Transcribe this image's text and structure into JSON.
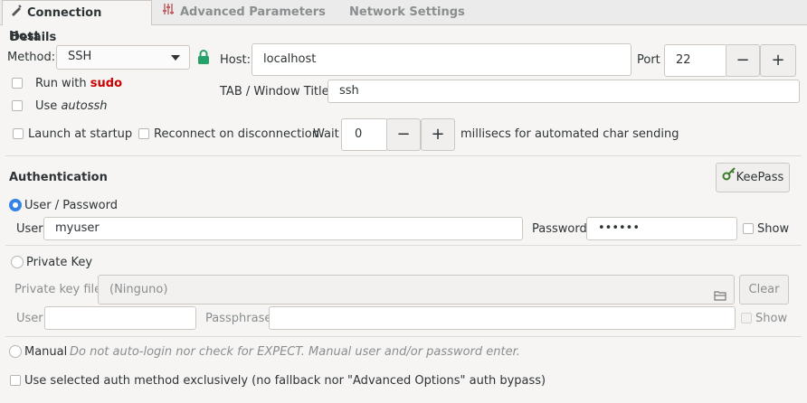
{
  "tabs": [
    {
      "label": "Connection Details"
    },
    {
      "label": "Advanced Parameters"
    },
    {
      "label": "Network Settings"
    }
  ],
  "host_section": {
    "title": "Host",
    "method_label": "Method:",
    "method_value": "SSH",
    "host_label": "Host:",
    "host_value": "localhost",
    "port_label": "Port",
    "port_value": "22",
    "run_with_prefix": "Run with",
    "run_with_cmd": "sudo",
    "use_prefix": "Use",
    "use_cmd": "autossh",
    "title_label": "TAB / Window Title:",
    "title_value": "ssh"
  },
  "options": {
    "launch_at_startup": "Launch at startup",
    "reconnect": "Reconnect on disconnection",
    "wait_label": "Wait",
    "wait_value": "0",
    "wait_suffix": "millisecs for automated char sending"
  },
  "auth": {
    "title": "Authentication",
    "keepass_label": "KeePass",
    "user_password_label": "User / Password",
    "user_label": "User",
    "user_value": "myuser",
    "password_label": "Password",
    "password_value": "••••••",
    "show_label": "Show",
    "private_key_label": "Private Key",
    "private_key_file_label": "Private key file",
    "private_key_file_value": "(Ninguno)",
    "clear_label": "Clear",
    "pk_user_label": "User",
    "passphrase_label": "Passphrase",
    "pk_show_label": "Show",
    "manual_label": "Manual",
    "manual_note": "Do not auto-login nor check for EXPECT. Manual user and/or password enter.",
    "exclusive_label": "Use selected auth method exclusively (no fallback nor \"Advanced Options\" auth bypass)"
  },
  "colors": {
    "sudo": "#cc0000",
    "accent": "#3584e4",
    "lock": "#26a269"
  }
}
